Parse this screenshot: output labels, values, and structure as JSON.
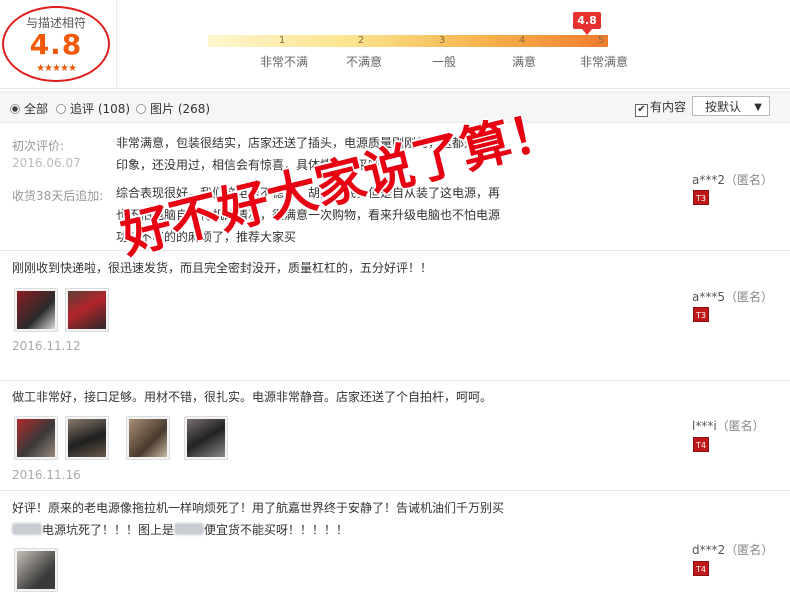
{
  "summary": {
    "label": "与描述相符",
    "score": "4.8",
    "stars": "★★★★★",
    "marker_value": "4.8",
    "scale": [
      {
        "num": "1",
        "label": "非常不满"
      },
      {
        "num": "2",
        "label": "不满意"
      },
      {
        "num": "3",
        "label": "一般"
      },
      {
        "num": "4",
        "label": "满意"
      },
      {
        "num": "5",
        "label": "非常满意"
      }
    ]
  },
  "filters": {
    "all": "全部",
    "followup": "追评 (108)",
    "images": "图片 (268)",
    "has_content": "有内容",
    "has_content_check": "✔",
    "sort": "按默认",
    "sort_caret": "▼"
  },
  "reviews": [
    {
      "initial_label": "初次评价:",
      "initial_date": "2016.06.07",
      "initial_text": [
        "非常满意，包装很结实，店家还送了插头，电源质量刚刚的，这都是表面",
        "印象，还没用过，相信会有惊喜，具体情况追平吧"
      ],
      "followup_label": "收货38天后追加:",
      "followup_text": [
        "综合表现很好，我们这电压不稳定，胡高胡底，但是自从装了这电源，再",
        "也不怕电脑自动待机的情况，很满意一次购物，看来升级电脑也不怕电源",
        "功耗不够的的麻烦了，推荐大家买"
      ],
      "user": "a***2",
      "anon": "（匿名）",
      "badge": "T3"
    },
    {
      "text": "刚刚收到快递啦，很迅速发货，而且完全密封没开，质量杠杠的，五分好评！！",
      "date": "2016.11.12",
      "user": "a***5",
      "anon": "（匿名）",
      "badge": "T3"
    },
    {
      "text": "做工非常好，接口足够。用材不错，很扎实。电源非常静音。店家还送了个自拍杆，呵呵。",
      "date": "2016.11.16",
      "user": "l***i",
      "anon": "（匿名）",
      "badge": "T4"
    },
    {
      "text_line1": "好评！原来的老电源像拖拉机一样响烦死了！用了航嘉世界终于安静了！告诫机油们千万别买",
      "text_line2a": "电源坑死了！！！图上是",
      "text_line2b": "便宜货不能买呀！！！！！",
      "user": "d***2",
      "anon": "（匿名）",
      "badge": "T4"
    }
  ],
  "overlay_text": "好不好大家说了算！",
  "colors": {
    "accent": "#f25a0a",
    "red": "#e60012",
    "badge": "#c0191b"
  }
}
